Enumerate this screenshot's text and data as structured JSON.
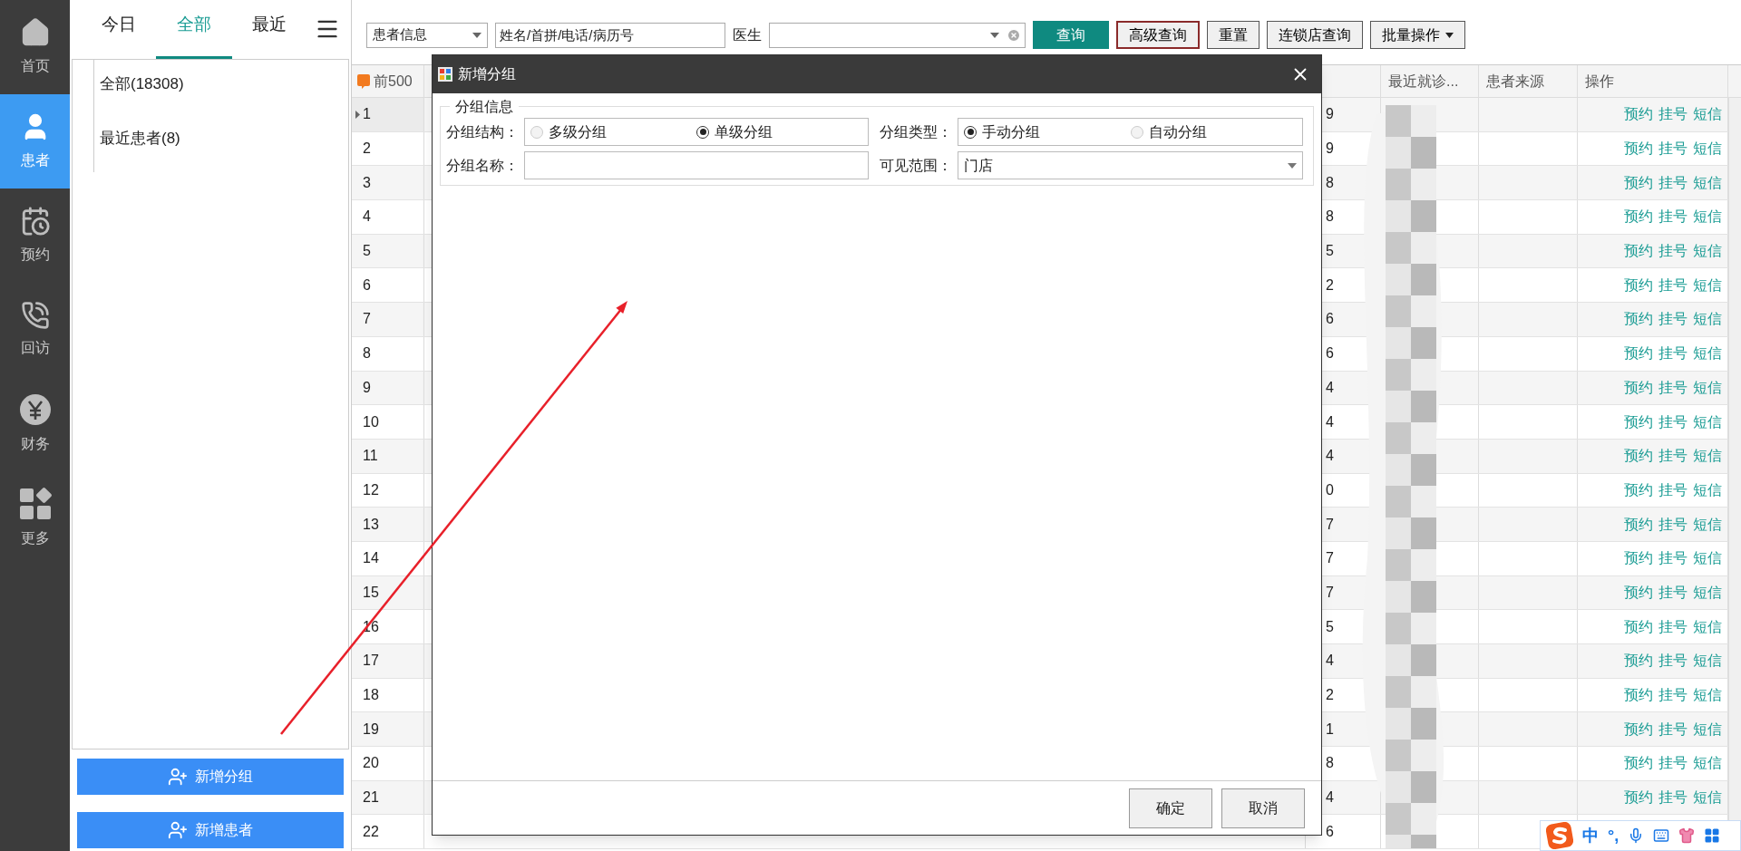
{
  "nav": [
    {
      "label": "首页",
      "kind": "home",
      "selected": false
    },
    {
      "label": "患者",
      "kind": "patient",
      "selected": true
    },
    {
      "label": "预约",
      "kind": "calendar",
      "selected": false
    },
    {
      "label": "回访",
      "kind": "phone",
      "selected": false
    },
    {
      "label": "财务",
      "kind": "money",
      "selected": false
    },
    {
      "label": "更多",
      "kind": "more",
      "selected": false
    }
  ],
  "group_panel": {
    "tabs": [
      {
        "label": "今日",
        "selected": false
      },
      {
        "label": "全部",
        "selected": true
      },
      {
        "label": "最近",
        "selected": false
      }
    ],
    "items": [
      "全部(18308)",
      "最近患者(8)"
    ],
    "buttons": [
      "新增分组",
      "新增患者"
    ]
  },
  "toolbar": {
    "search_type": "患者信息",
    "search": {
      "placeholder": "姓名/首拼/电话/病历号"
    },
    "doctor_label": "医生",
    "buttons": [
      {
        "label": "查询",
        "kind": "primary"
      },
      {
        "label": "高级查询",
        "kind": "outlined"
      },
      {
        "label": "重置",
        "kind": "plain"
      },
      {
        "label": "连锁店查询",
        "kind": "plain"
      },
      {
        "label": "批量操作",
        "kind": "menu"
      }
    ]
  },
  "table": {
    "row_header": "前500",
    "columns": [
      "最近就诊...",
      "患者来源",
      "操作"
    ],
    "rows": [
      {
        "number": "1",
        "current": true,
        "column_2": "9",
        "actions": [
          "预约",
          "挂号",
          "短信"
        ]
      },
      {
        "number": "2",
        "current": false,
        "column_2": "9",
        "actions": [
          "预约",
          "挂号",
          "短信"
        ]
      },
      {
        "number": "3",
        "current": false,
        "column_2": "8",
        "actions": [
          "预约",
          "挂号",
          "短信"
        ]
      },
      {
        "number": "4",
        "current": false,
        "column_2": "8",
        "actions": [
          "预约",
          "挂号",
          "短信"
        ]
      },
      {
        "number": "5",
        "current": false,
        "column_2": "5",
        "actions": [
          "预约",
          "挂号",
          "短信"
        ]
      },
      {
        "number": "6",
        "current": false,
        "column_2": "2",
        "actions": [
          "预约",
          "挂号",
          "短信"
        ]
      },
      {
        "number": "7",
        "current": false,
        "column_2": "6",
        "actions": [
          "预约",
          "挂号",
          "短信"
        ]
      },
      {
        "number": "8",
        "current": false,
        "column_2": "6",
        "actions": [
          "预约",
          "挂号",
          "短信"
        ]
      },
      {
        "number": "9",
        "current": false,
        "column_2": "4",
        "actions": [
          "预约",
          "挂号",
          "短信"
        ]
      },
      {
        "number": "10",
        "current": false,
        "column_2": "4",
        "actions": [
          "预约",
          "挂号",
          "短信"
        ]
      },
      {
        "number": "11",
        "current": false,
        "column_2": "4",
        "actions": [
          "预约",
          "挂号",
          "短信"
        ]
      },
      {
        "number": "12",
        "current": false,
        "column_2": "0",
        "actions": [
          "预约",
          "挂号",
          "短信"
        ]
      },
      {
        "number": "13",
        "current": false,
        "column_2": "7",
        "actions": [
          "预约",
          "挂号",
          "短信"
        ]
      },
      {
        "number": "14",
        "current": false,
        "column_2": "7",
        "actions": [
          "预约",
          "挂号",
          "短信"
        ]
      },
      {
        "number": "15",
        "current": false,
        "column_2": "7",
        "actions": [
          "预约",
          "挂号",
          "短信"
        ]
      },
      {
        "number": "16",
        "current": false,
        "column_2": "5",
        "actions": [
          "预约",
          "挂号",
          "短信"
        ]
      },
      {
        "number": "17",
        "current": false,
        "column_2": "4",
        "actions": [
          "预约",
          "挂号",
          "短信"
        ]
      },
      {
        "number": "18",
        "current": false,
        "column_2": "2",
        "actions": [
          "预约",
          "挂号",
          "短信"
        ]
      },
      {
        "number": "19",
        "current": false,
        "column_2": "1",
        "actions": [
          "预约",
          "挂号",
          "短信"
        ]
      },
      {
        "number": "20",
        "current": false,
        "column_2": "8",
        "actions": [
          "预约",
          "挂号",
          "短信"
        ]
      },
      {
        "number": "21",
        "current": false,
        "column_2": "4",
        "actions": [
          "预约",
          "挂号",
          "短信"
        ]
      },
      {
        "number": "22",
        "current": false,
        "column_2": "6",
        "actions": []
      }
    ]
  },
  "dialog": {
    "title": "新增分组",
    "fieldset": "分组信息",
    "fields": [
      {
        "kind": "radio",
        "label": "分组结构：",
        "options": [
          {
            "label": "多级分组",
            "selected": false
          },
          {
            "label": "单级分组",
            "selected": true
          }
        ]
      },
      {
        "kind": "radio",
        "label": "分组类型：",
        "options": [
          {
            "label": "手动分组",
            "selected": true
          },
          {
            "label": "自动分组",
            "selected": false
          }
        ]
      },
      {
        "kind": "text",
        "label": "分组名称："
      },
      {
        "kind": "select",
        "label": "可见范围：",
        "value": "门店"
      }
    ],
    "buttons": [
      "确定",
      "取消"
    ]
  },
  "ime": {
    "items": [
      "中",
      "°,"
    ]
  }
}
